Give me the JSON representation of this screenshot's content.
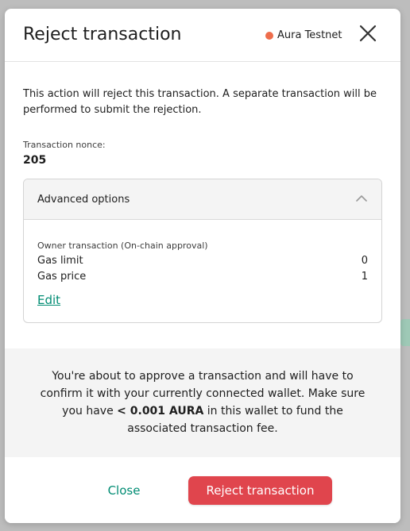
{
  "dialog": {
    "title": "Reject transaction",
    "network_label": "Aura Testnet",
    "close_icon": "close-icon"
  },
  "body": {
    "description": "This action will reject this transaction. A separate transaction will be performed to submit the rejection.",
    "nonce_label": "Transaction nonce:",
    "nonce_value": "205"
  },
  "advanced": {
    "title": "Advanced options",
    "expanded": true,
    "owner_label": "Owner transaction (On-chain approval)",
    "gas_limit_label": "Gas limit",
    "gas_limit_value": "0",
    "gas_price_label": "Gas price",
    "gas_price_value": "1",
    "edit_label": "Edit"
  },
  "notice": {
    "text_before": "You're about to approve a transaction and will have to confirm it with your currently connected wallet. Make sure you have ",
    "amount": "< 0.001 AURA",
    "text_after": " in this wallet to fund the associated transaction fee."
  },
  "footer": {
    "close_label": "Close",
    "reject_label": "Reject transaction"
  },
  "colors": {
    "accent": "#008c73",
    "danger": "#e0454d",
    "network_dot": "#ee6d4c"
  }
}
